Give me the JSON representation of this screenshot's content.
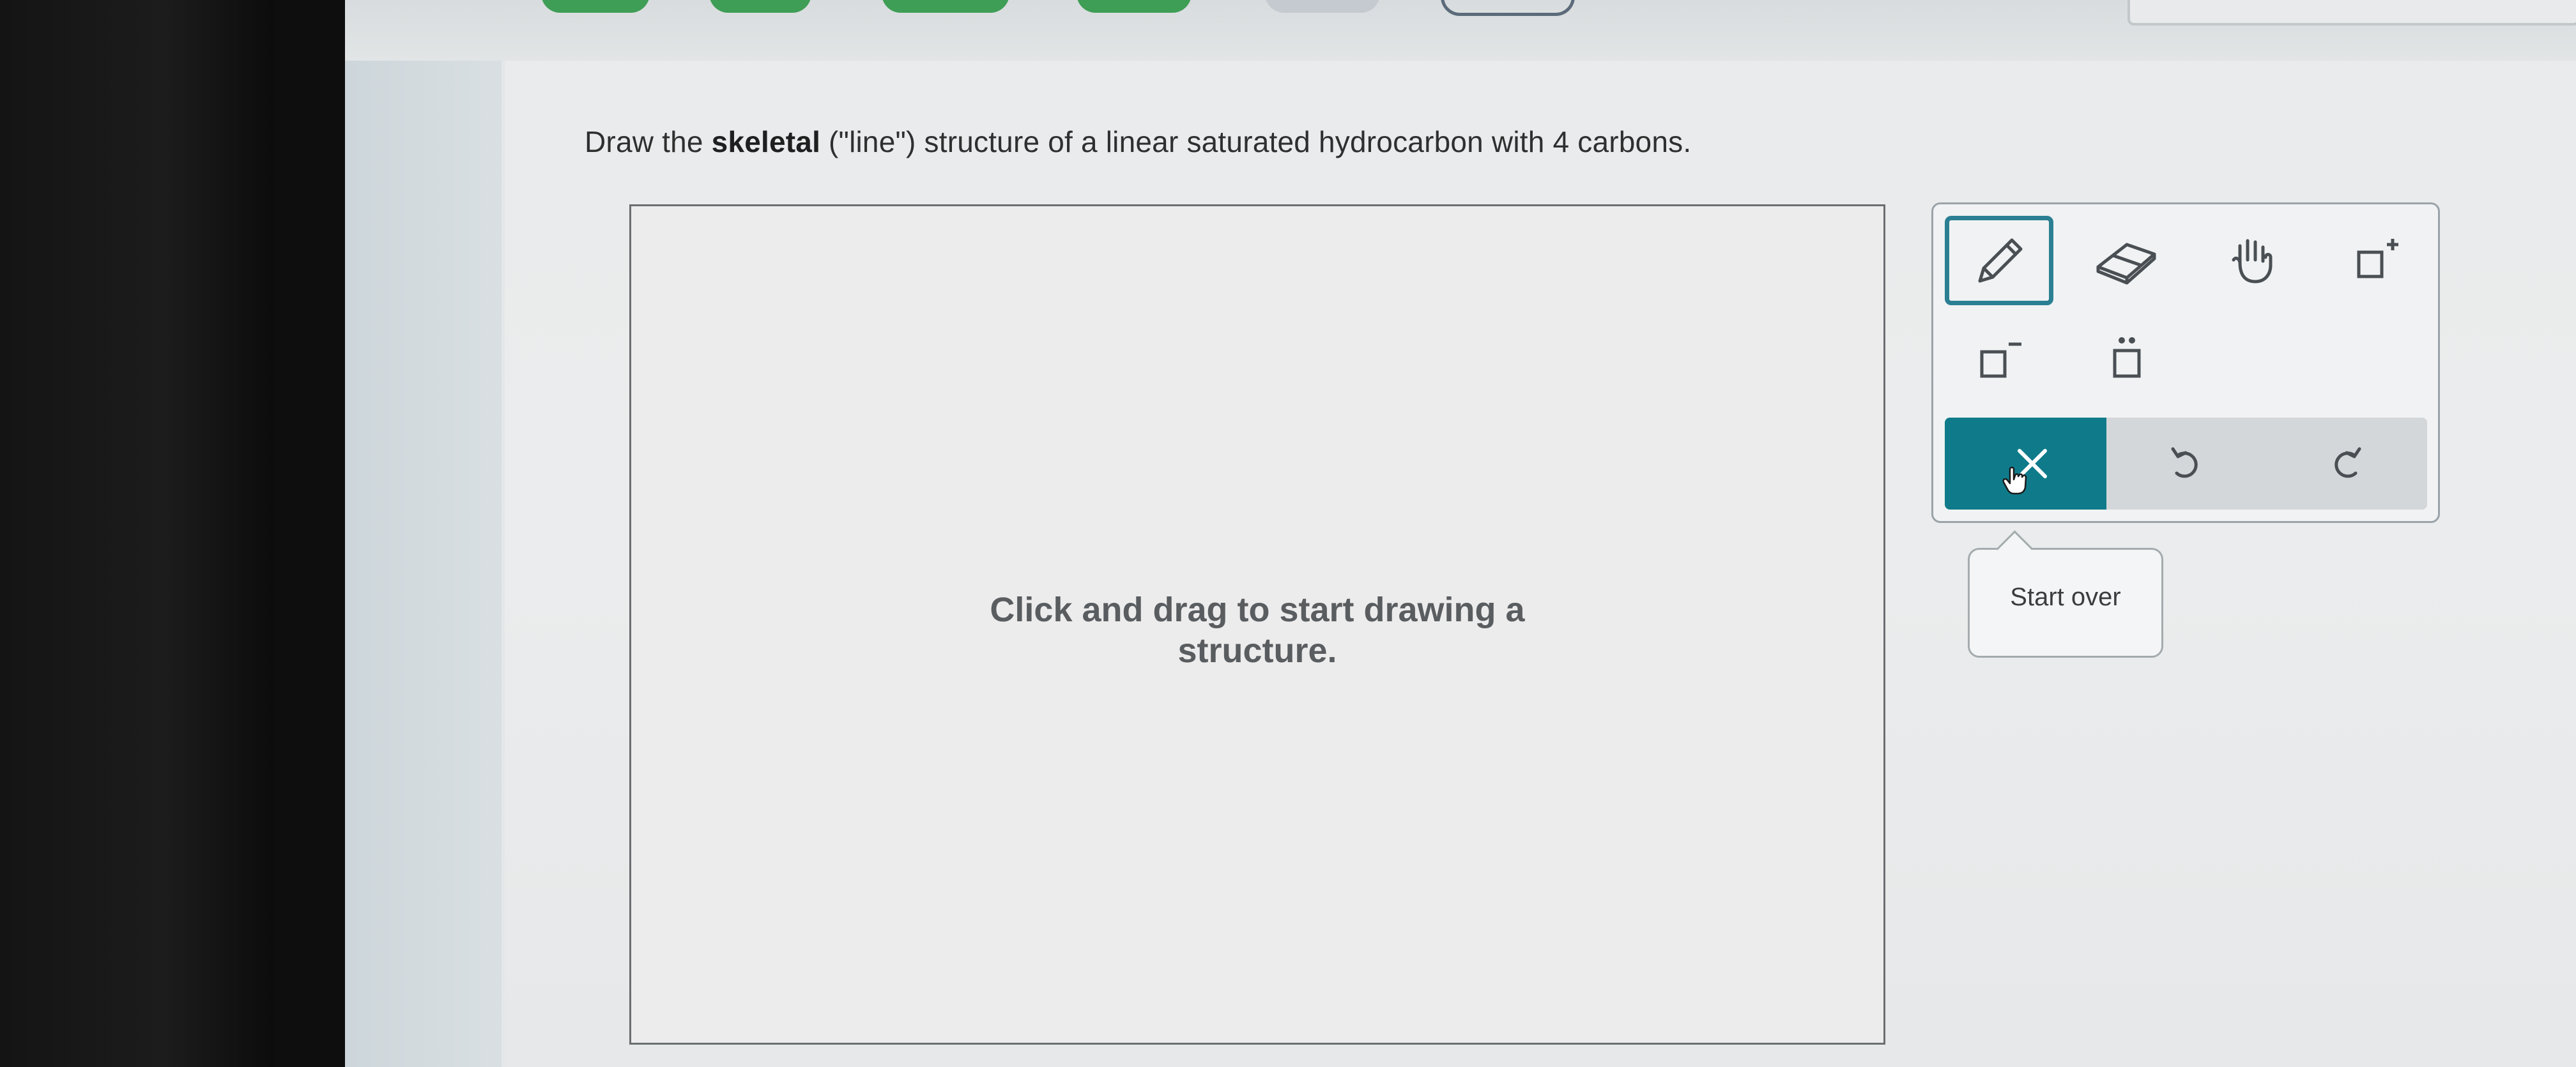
{
  "question": {
    "prefix": "Draw the ",
    "bold": "skeletal",
    "suffix": " (\"line\") structure of a linear saturated hydrocarbon with 4 carbons."
  },
  "canvas": {
    "placeholder_line1": "Click and drag to start drawing a",
    "placeholder_line2": "structure."
  },
  "toolbar": {
    "tools": [
      "pencil-icon",
      "eraser-icon",
      "hand-icon",
      "add-charge-icon",
      "remove-charge-icon",
      "lone-pair-icon"
    ],
    "active_tool": "pencil-icon",
    "actions": [
      "clear-icon",
      "undo-icon",
      "redo-icon"
    ],
    "accent_color": "#0f7b8a"
  },
  "tooltip": {
    "text": "Start over"
  },
  "colors": {
    "progress_complete": "#3e9e55",
    "active_border": "#2b7f93"
  }
}
